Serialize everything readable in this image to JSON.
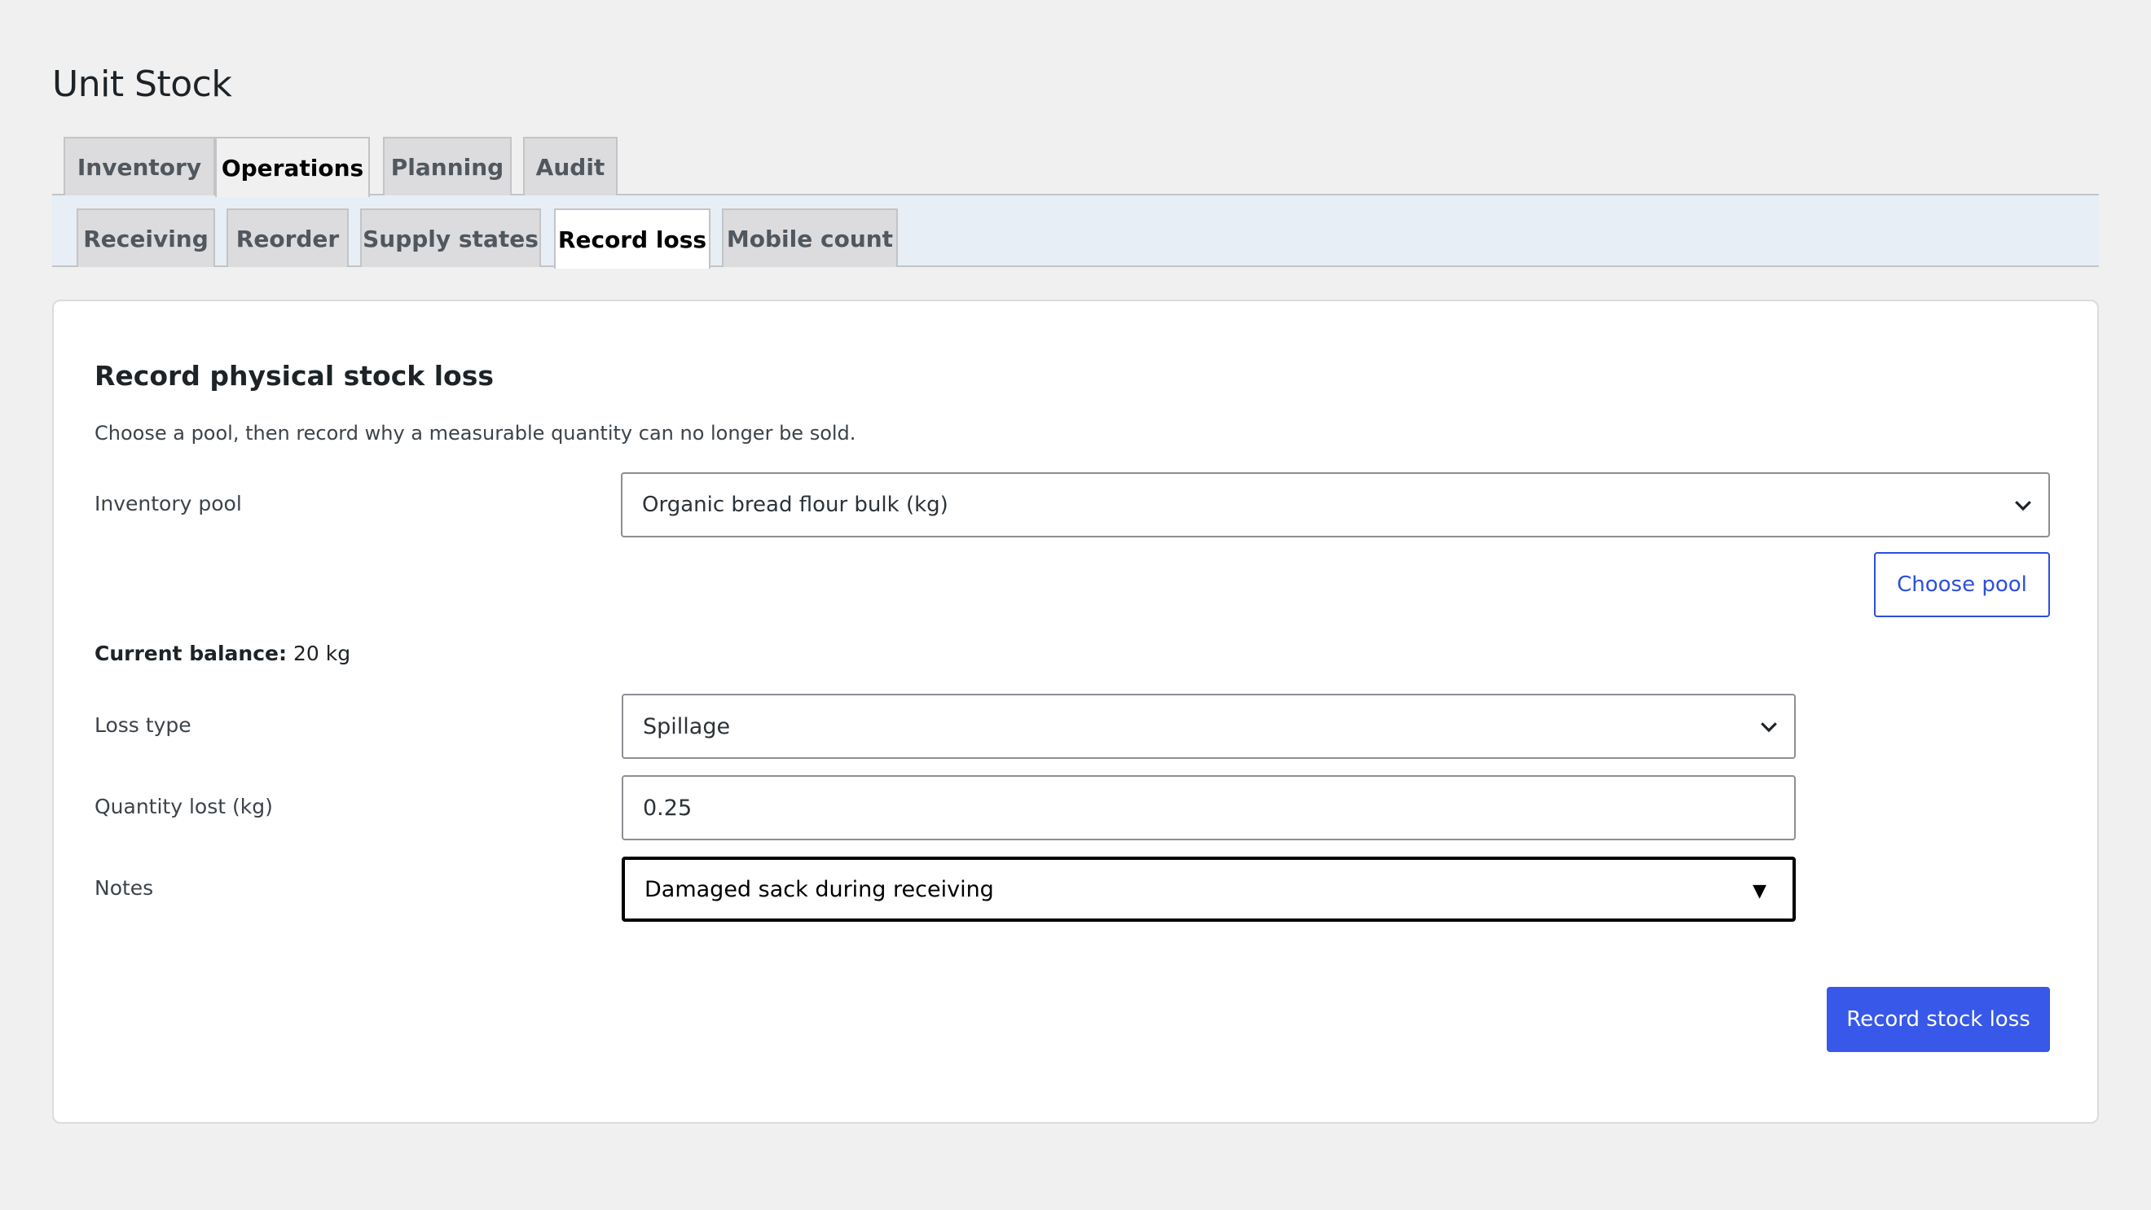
{
  "page_title": "Unit Stock",
  "primary_tabs": [
    {
      "label": "Inventory",
      "active": false
    },
    {
      "label": "Operations",
      "active": true
    },
    {
      "label": "Planning",
      "active": false
    },
    {
      "label": "Audit",
      "active": false
    }
  ],
  "secondary_tabs": [
    {
      "label": "Receiving",
      "active": false
    },
    {
      "label": "Reorder",
      "active": false
    },
    {
      "label": "Supply states",
      "active": false
    },
    {
      "label": "Record loss",
      "active": true
    },
    {
      "label": "Mobile count",
      "active": false
    }
  ],
  "form": {
    "title": "Record physical stock loss",
    "description": "Choose a pool, then record why a measurable quantity can no longer be sold.",
    "inventory_pool": {
      "label": "Inventory pool",
      "value": "Organic bread flour bulk (kg)"
    },
    "choose_pool_button": "Choose pool",
    "current_balance": {
      "label": "Current balance:",
      "value": "20 kg"
    },
    "loss_type": {
      "label": "Loss type",
      "value": "Spillage"
    },
    "quantity_lost": {
      "label": "Quantity lost (kg)",
      "value": "0.25"
    },
    "notes": {
      "label": "Notes",
      "value": "Damaged sack during receiving"
    },
    "submit_button": "Record stock loss"
  },
  "colors": {
    "primary_button": "#3858e9",
    "outline_button": "#2c4fdc",
    "secondary_strip": "#e7eef6",
    "background": "#f0f0f1"
  }
}
